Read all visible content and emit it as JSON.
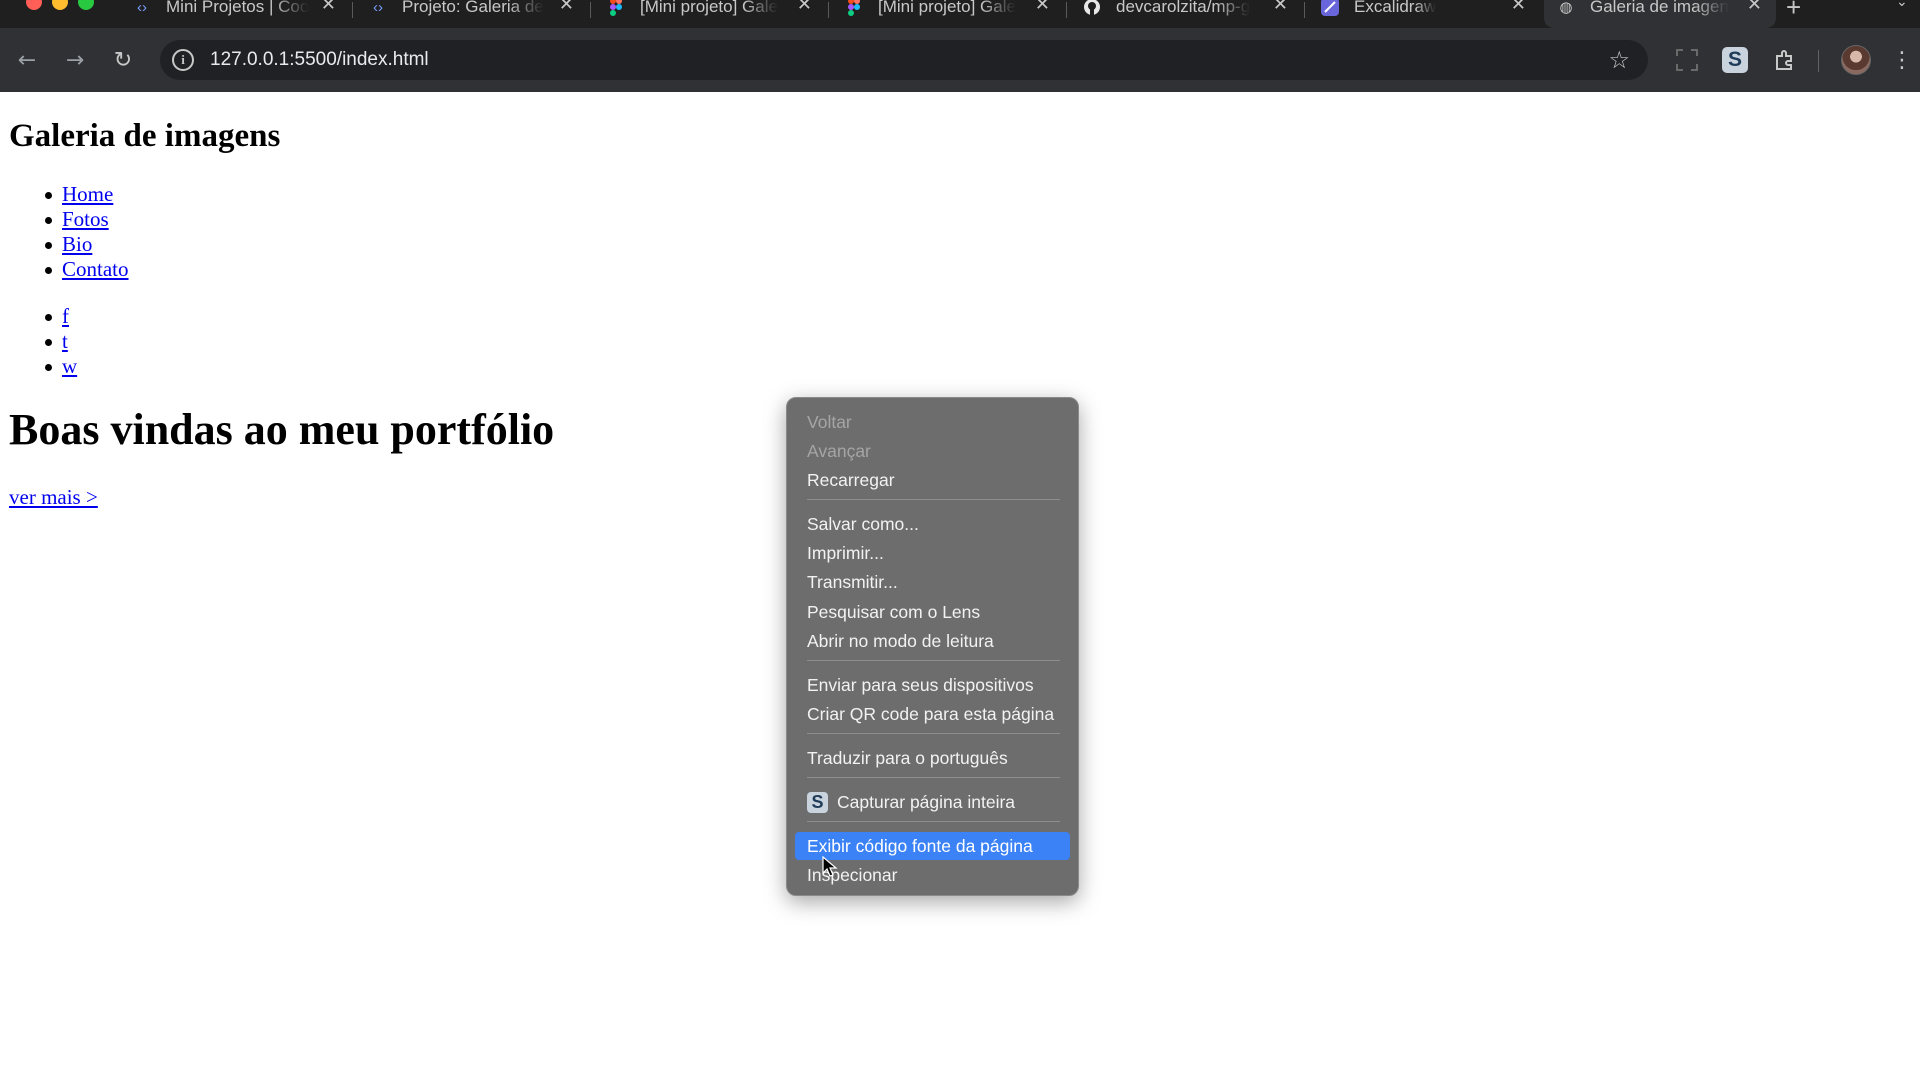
{
  "browser": {
    "tabs": [
      {
        "label": "Mini Projetos | Coo",
        "icon": "code-icon"
      },
      {
        "label": "Projeto: Galeria de",
        "icon": "code-icon"
      },
      {
        "label": "[Mini projeto] Gale",
        "icon": "figma-icon"
      },
      {
        "label": "[Mini projeto] Gale",
        "icon": "figma-icon"
      },
      {
        "label": "devcarolzita/mp-g",
        "icon": "github-icon"
      },
      {
        "label": "Excalidraw",
        "icon": "excalidraw-icon"
      },
      {
        "label": "Galeria de imagen",
        "icon": "globe-icon",
        "active": true
      }
    ],
    "url": "127.0.0.1:5500/index.html",
    "extension_label": "S"
  },
  "page": {
    "title": "Galeria de imagens",
    "nav": [
      "Home",
      "Fotos",
      "Bio",
      "Contato"
    ],
    "social": [
      "f",
      "t",
      "w"
    ],
    "hero_title": "Boas vindas ao meu portfólio",
    "hero_link": "ver mais >"
  },
  "context_menu": {
    "groups": [
      [
        {
          "label": "Voltar",
          "disabled": true
        },
        {
          "label": "Avançar",
          "disabled": true
        },
        {
          "label": "Recarregar"
        }
      ],
      [
        {
          "label": "Salvar como..."
        },
        {
          "label": "Imprimir..."
        },
        {
          "label": "Transmitir..."
        },
        {
          "label": "Pesquisar com o Lens"
        },
        {
          "label": "Abrir no modo de leitura"
        }
      ],
      [
        {
          "label": "Enviar para seus dispositivos"
        },
        {
          "label": "Criar QR code para esta página"
        }
      ],
      [
        {
          "label": "Traduzir para o português"
        }
      ],
      [
        {
          "label": "Capturar página inteira",
          "icon_label": "S"
        }
      ],
      [
        {
          "label": "Exibir código fonte da página",
          "highlighted": true
        },
        {
          "label": "Inspecionar"
        }
      ]
    ]
  },
  "colors": {
    "highlight": "#3b82f6",
    "link": "#0000ee",
    "menu_bg": "#6d6d6d"
  }
}
